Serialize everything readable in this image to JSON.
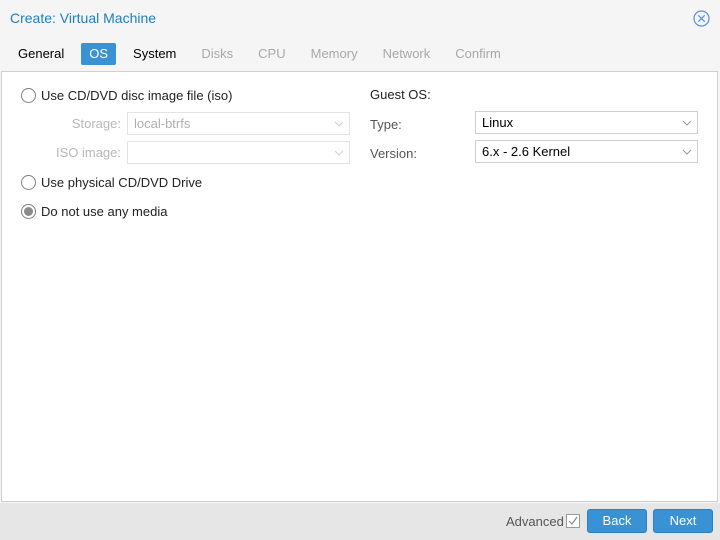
{
  "window": {
    "title": "Create: Virtual Machine",
    "close_icon": "circle-x-icon"
  },
  "tabs": [
    {
      "label": "General",
      "state": "normal"
    },
    {
      "label": "OS",
      "state": "active"
    },
    {
      "label": "System",
      "state": "normal"
    },
    {
      "label": "Disks",
      "state": "disabled"
    },
    {
      "label": "CPU",
      "state": "disabled"
    },
    {
      "label": "Memory",
      "state": "disabled"
    },
    {
      "label": "Network",
      "state": "disabled"
    },
    {
      "label": "Confirm",
      "state": "disabled"
    }
  ],
  "media": {
    "options": [
      {
        "label": "Use CD/DVD disc image file (iso)",
        "checked": false
      },
      {
        "label": "Use physical CD/DVD Drive",
        "checked": false
      },
      {
        "label": "Do not use any media",
        "checked": true
      }
    ],
    "storage": {
      "label": "Storage:",
      "value": "local-btrfs",
      "disabled": true
    },
    "iso_image": {
      "label": "ISO image:",
      "value": "",
      "disabled": true
    }
  },
  "guest_os": {
    "heading": "Guest OS:",
    "type": {
      "label": "Type:",
      "value": "Linux"
    },
    "version": {
      "label": "Version:",
      "value": "6.x - 2.6 Kernel"
    }
  },
  "footer": {
    "advanced_label": "Advanced",
    "advanced_checked": true,
    "back_label": "Back",
    "next_label": "Next"
  },
  "colors": {
    "accent": "#3892d4",
    "title": "#1c7fc4"
  }
}
